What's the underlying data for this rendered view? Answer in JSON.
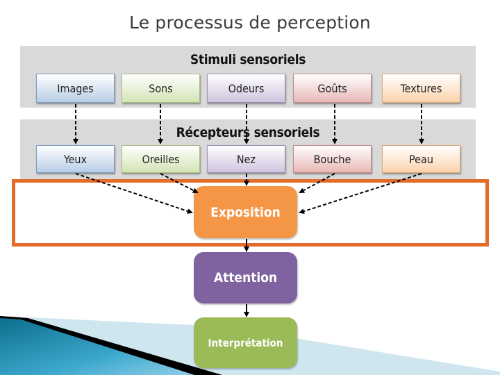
{
  "title": "Le processus de perception",
  "stimuli": {
    "heading": "Stimuli sensoriels",
    "items": [
      "Images",
      "Sons",
      "Odeurs",
      "Goûts",
      "Textures"
    ]
  },
  "receptors": {
    "heading": "Récepteurs sensoriels",
    "items": [
      "Yeux",
      "Oreilles",
      "Nez",
      "Bouche",
      "Peau"
    ]
  },
  "stages": {
    "exposition": "Exposition",
    "attention": "Attention",
    "interpretation": "Interprétation"
  },
  "colors": {
    "frame": "#e36c29",
    "exposition": "#f59646",
    "attention": "#7f63a0",
    "interpretation": "#9bbb59",
    "panel": "#d9d9d9"
  }
}
